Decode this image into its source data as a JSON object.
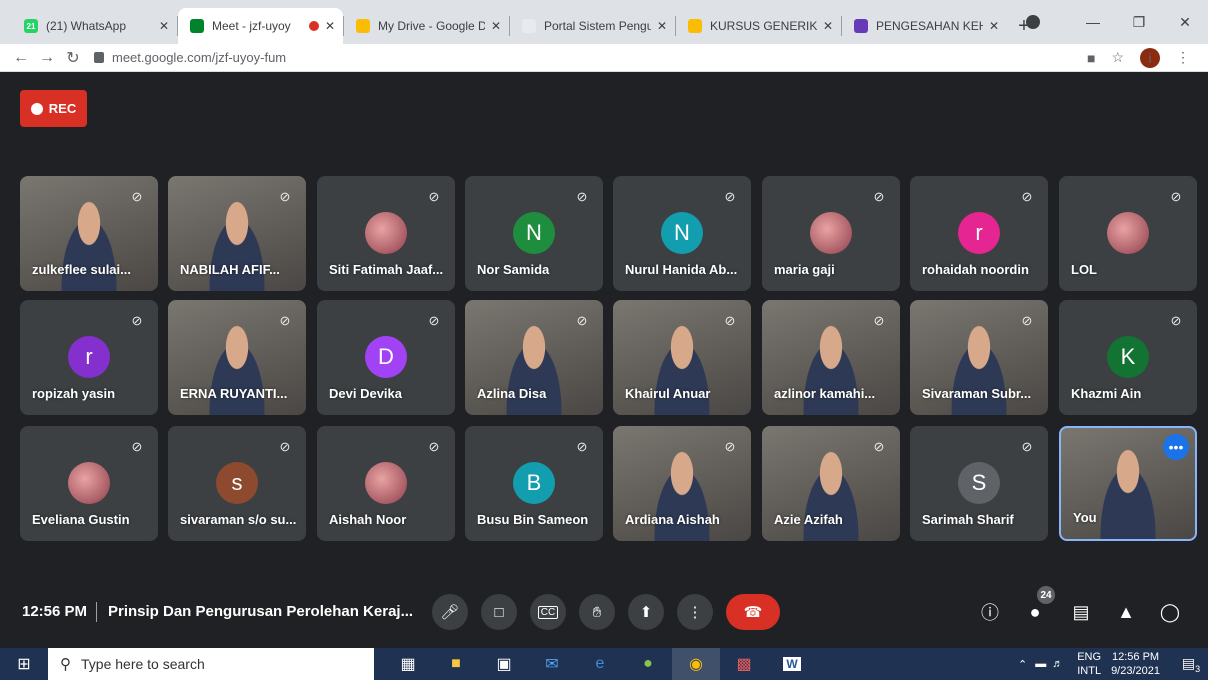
{
  "browser": {
    "tabs": [
      {
        "title": "(21) WhatsApp",
        "favicon_color": "#25d366",
        "favicon_text": "21",
        "active": false
      },
      {
        "title": "Meet - jzf-uyoy",
        "favicon_color": "#00832d",
        "favicon_text": "",
        "active": true,
        "recording": true
      },
      {
        "title": "My Drive - Google D",
        "favicon_color": "#fbbc04",
        "favicon_text": "",
        "active": false
      },
      {
        "title": "Portal Sistem Pengu",
        "favicon_color": "#e8eaed",
        "favicon_text": "",
        "active": false
      },
      {
        "title": "KURSUS GENERIK -",
        "favicon_color": "#fbbc04",
        "favicon_text": "",
        "active": false
      },
      {
        "title": "PENGESAHAN KEHA",
        "favicon_color": "#673ab7",
        "favicon_text": "",
        "active": false
      }
    ],
    "new_tab_label": "+",
    "url": "meet.google.com/jzf-uyoy-fum",
    "profile_initial": "i"
  },
  "meet": {
    "rec_label": "REC",
    "participants": [
      {
        "name": "zulkeflee sulai...",
        "type": "video",
        "avatar_letter": "",
        "avatar_color": ""
      },
      {
        "name": "NABILAH AFIF...",
        "type": "video",
        "avatar_letter": "",
        "avatar_color": ""
      },
      {
        "name": "Siti Fatimah Jaaf...",
        "type": "photo",
        "avatar_letter": "",
        "avatar_color": ""
      },
      {
        "name": "Nor Samida",
        "type": "letter",
        "avatar_letter": "N",
        "avatar_color": "#1e8e3e"
      },
      {
        "name": "Nurul Hanida Ab...",
        "type": "letter",
        "avatar_letter": "N",
        "avatar_color": "#129eaf"
      },
      {
        "name": "maria gaji",
        "type": "photo",
        "avatar_letter": "",
        "avatar_color": ""
      },
      {
        "name": "rohaidah noordin",
        "type": "letter",
        "avatar_letter": "r",
        "avatar_color": "#e52592"
      },
      {
        "name": "LOL",
        "type": "photo",
        "avatar_letter": "",
        "avatar_color": ""
      },
      {
        "name": "ropizah yasin",
        "type": "letter",
        "avatar_letter": "r",
        "avatar_color": "#8430ce"
      },
      {
        "name": "ERNA RUYANTI...",
        "type": "video",
        "avatar_letter": "",
        "avatar_color": ""
      },
      {
        "name": "Devi Devika",
        "type": "letter",
        "avatar_letter": "D",
        "avatar_color": "#a142f4"
      },
      {
        "name": "Azlina Disa",
        "type": "video",
        "avatar_letter": "",
        "avatar_color": ""
      },
      {
        "name": "Khairul Anuar",
        "type": "video",
        "avatar_letter": "",
        "avatar_color": ""
      },
      {
        "name": "azlinor kamahi...",
        "type": "video",
        "avatar_letter": "",
        "avatar_color": ""
      },
      {
        "name": "Sivaraman Subr...",
        "type": "video",
        "avatar_letter": "",
        "avatar_color": ""
      },
      {
        "name": "Khazmi Ain",
        "type": "letter",
        "avatar_letter": "K",
        "avatar_color": "#137333"
      },
      {
        "name": "Eveliana Gustin",
        "type": "photo",
        "avatar_letter": "",
        "avatar_color": ""
      },
      {
        "name": "sivaraman s/o su...",
        "type": "letter",
        "avatar_letter": "s",
        "avatar_color": "#8d4a2f"
      },
      {
        "name": "Aishah Noor",
        "type": "photo",
        "avatar_letter": "",
        "avatar_color": ""
      },
      {
        "name": "Busu Bin Sameon",
        "type": "letter",
        "avatar_letter": "B",
        "avatar_color": "#129eaf"
      },
      {
        "name": "Ardiana Aishah",
        "type": "video",
        "avatar_letter": "",
        "avatar_color": ""
      },
      {
        "name": "Azie Azifah",
        "type": "video",
        "avatar_letter": "",
        "avatar_color": ""
      },
      {
        "name": "Sarimah Sharif",
        "type": "letter",
        "avatar_letter": "S",
        "avatar_color": "#5f6368"
      },
      {
        "name": "You",
        "type": "self",
        "avatar_letter": "",
        "avatar_color": ""
      }
    ],
    "time": "12:56 PM",
    "meeting_title": "Prinsip Dan Pengurusan Perolehan Keraj...",
    "people_count": "24"
  },
  "taskbar": {
    "search_placeholder": "Type here to search",
    "language_top": "ENG",
    "language_bottom": "INTL",
    "clock_time": "12:56 PM",
    "clock_date": "9/23/2021",
    "notification_count": "3"
  }
}
